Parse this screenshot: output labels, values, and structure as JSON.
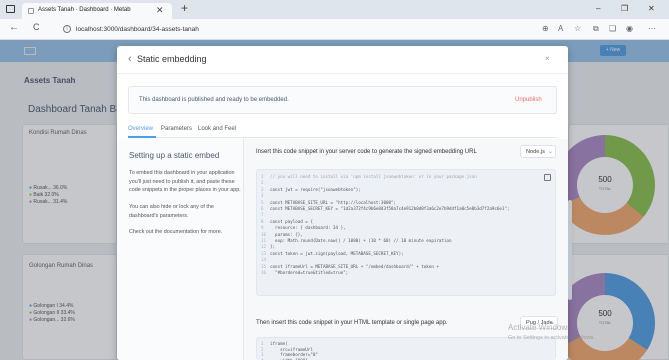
{
  "browser": {
    "tab_title": "Assets Tanah · Dashboard · Metab",
    "tab_close": "✕",
    "new_tab": "+",
    "url": "localhost:3000/dashboard/34-assets-tanah",
    "nav": {
      "back": "←",
      "reload": "C"
    },
    "window": {
      "minimize": "–",
      "restore": "❐",
      "close": "✕"
    },
    "tool_icons": [
      "zoom-icon",
      "read-aloud-icon",
      "favorite-icon",
      "split-icon",
      "collections-icon",
      "profile-icon",
      "menu-icon"
    ]
  },
  "app": {
    "collection_title": "Assets Tanah",
    "dashboard_title": "Dashboard Tanah Bang",
    "new_button": "+ New",
    "cards": [
      {
        "title": "Kondisi Rumah Dinas",
        "legend": [
          "Rusak... 36.0%",
          "Baik 32.0%",
          "Rusak... 31.4%"
        ],
        "total": "500",
        "total_label": "TOTAL"
      },
      {
        "title": "Golongan Rumah Dinas",
        "legend": [
          "Golongan I 34.4%",
          "Golongan II 33.4%",
          "Golongan... 32.6%"
        ],
        "total": "500",
        "total_label": "TOTAL"
      }
    ]
  },
  "modal": {
    "title": "Static embedding",
    "close": "×",
    "back": "‹",
    "notice": "This dashboard is published and ready to be embedded.",
    "unpublish": "Unpublish",
    "tabs": [
      "Overview",
      "Parameters",
      "Look and Feel"
    ],
    "left": {
      "title": "Setting up a static embed",
      "p1": "To embed this dashboard in your application you'll just need to publish it, and paste these code snippets in the proper places in your app.",
      "p2": "You can also hide or lock any of the dashboard's parameters.",
      "p3": "Check out the documentation for more."
    },
    "server": {
      "label": "Insert this code snippet in your server code to generate the signed embedding URL",
      "select": "Node.js",
      "code": [
        "// you will need to install via 'npm install jsonwebtoken' or in your package.json",
        "",
        "const jwt = require(\"jsonwebtoken\");",
        "",
        "const METABASE_SITE_URL = \"http://localhost:3000\";",
        "const METABASE_SECRET_KEY = \"1d2a372f4c9b6e0d3f58a7c4e912b0d8f3a6c2e7b9d4f1a0c5e8b3d7f2a9c6e1\";",
        "",
        "const payload = {",
        "  resource: { dashboard: 34 },",
        "  params: {},",
        "  exp: Math.round(Date.now() / 1000) + (10 * 60) // 10 minute expiration",
        "};",
        "const token = jwt.sign(payload, METABASE_SECRET_KEY);",
        "",
        "const iframeUrl = METABASE_SITE_URL + \"/embed/dashboard/\" + token +",
        "  \"#bordered=true&titled=true\";"
      ]
    },
    "client": {
      "label": "Then insert this code snippet in your HTML template or single page app.",
      "select": "Pug / Jade",
      "code": [
        "iframe(",
        "    src=iframeUrl",
        "    frameborder=\"0\"",
        "    width=\"800\""
      ]
    }
  },
  "watermark": {
    "title": "Activate Windows",
    "subtitle": "Go to Settings to activate Windows."
  },
  "colors": {
    "brand": "#509ee3",
    "danger": "#ed6e6e",
    "green": "#88bf4d",
    "orange": "#f2a86f",
    "purple": "#a989c5"
  }
}
